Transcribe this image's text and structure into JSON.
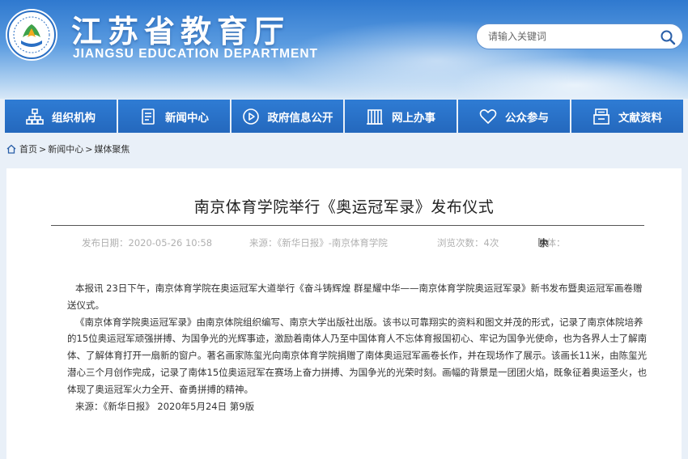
{
  "header": {
    "title": "江苏省教育厅",
    "subtitle": "JIANGSU EDUCATION DEPARTMENT",
    "search_placeholder": "请输入关键词"
  },
  "nav": [
    {
      "label": "组织机构",
      "icon": "org-chart-icon"
    },
    {
      "label": "新闻中心",
      "icon": "document-icon"
    },
    {
      "label": "政府信息公开",
      "icon": "play-circle-icon"
    },
    {
      "label": "网上办事",
      "icon": "building-icon"
    },
    {
      "label": "公众参与",
      "icon": "heart-icon"
    },
    {
      "label": "文献资料",
      "icon": "archive-icon"
    }
  ],
  "breadcrumb": {
    "home": "首页",
    "sep1": ">",
    "news": "新闻中心",
    "sep2": ">",
    "current": "媒体聚焦"
  },
  "article": {
    "title": "南京体育学院举行《奥运冠军录》发布仪式",
    "date": "发布日期：2020-05-26 10:58",
    "source": "来源：《新华日报》-南京体育学院",
    "views": "浏览次数：4次",
    "font_label": "字体：",
    "font_open": "[",
    "font_large": "大",
    "font_medium": "中",
    "font_small": "小",
    "font_close": "]",
    "paragraphs": [
      "本报讯 23日下午，南京体育学院在奥运冠军大道举行《奋斗铸辉煌 群星耀中华——南京体育学院奥运冠军录》新书发布暨奥运冠军画卷赠送仪式。",
      "《南京体育学院奥运冠军录》由南京体院组织编写、南京大学出版社出版。该书以可靠翔实的资料和图文并茂的形式，记录了南京体院培养的15位奥运冠军顽强拼搏、为国争光的光辉事迹，激励着南体人乃至中国体育人不忘体育报国初心、牢记为国争光使命，也为各界人士了解南体、了解体育打开一扇新的窗户。著名画家陈玺光向南京体育学院捐赠了南体奥运冠军画卷长作，并在现场作了展示。该画长11米，由陈玺光潜心三个月创作完成，记录了南体15位奥运冠军在赛场上奋力拼搏、为国争光的光荣时刻。画幅的背景是一团团火焰，既象征着奥运圣火，也体现了奥运冠军火力全开、奋勇拼搏的精神。",
      "来源：《新华日报》 2020年5月24日 第9版"
    ]
  },
  "colors": {
    "nav_bg": "#2a72c9",
    "header_top": "#2f79cf",
    "page_bg": "#e9f0f8"
  }
}
